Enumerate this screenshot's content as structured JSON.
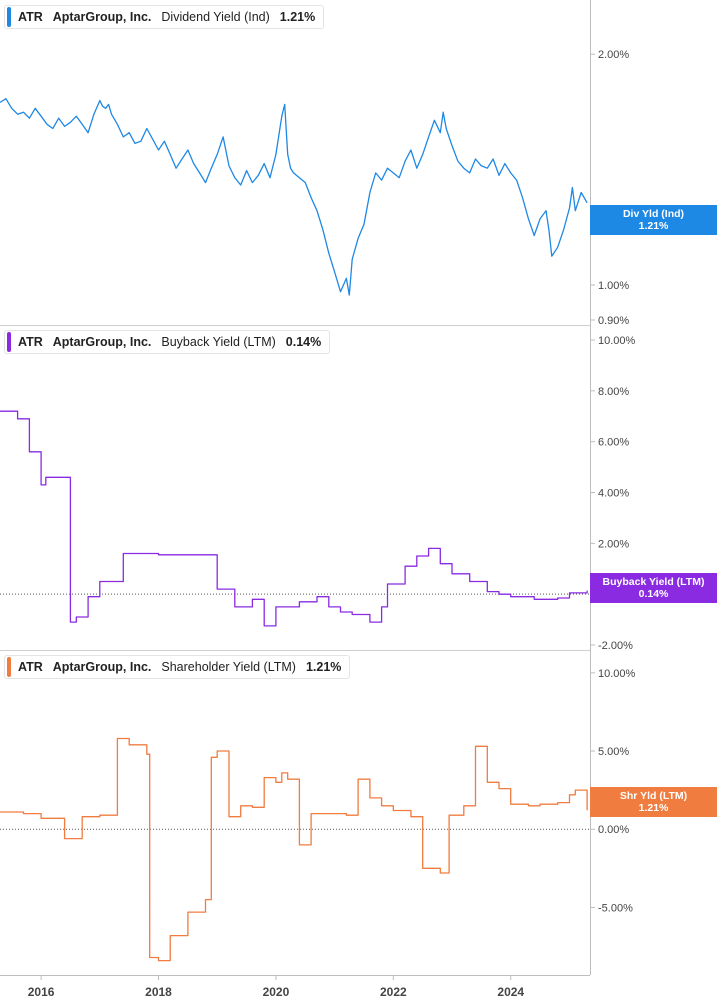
{
  "chart_data": [
    {
      "type": "line",
      "header": {
        "ticker": "ATR",
        "company": "AptarGroup, Inc.",
        "metric": "Dividend Yield (Ind)",
        "value": "1.21%"
      },
      "series": [
        {
          "name": "Dividend Yield (Ind)",
          "color": "#1e88e5",
          "x": [
            2015.3,
            2015.4,
            2015.5,
            2015.6,
            2015.7,
            2015.8,
            2015.9,
            2016.0,
            2016.1,
            2016.2,
            2016.3,
            2016.4,
            2016.5,
            2016.6,
            2016.7,
            2016.8,
            2016.9,
            2017.0,
            2017.05,
            2017.1,
            2017.15,
            2017.2,
            2017.3,
            2017.4,
            2017.5,
            2017.6,
            2017.7,
            2017.8,
            2017.9,
            2018.0,
            2018.1,
            2018.2,
            2018.3,
            2018.4,
            2018.5,
            2018.6,
            2018.7,
            2018.8,
            2018.9,
            2019.0,
            2019.1,
            2019.2,
            2019.3,
            2019.4,
            2019.5,
            2019.6,
            2019.7,
            2019.8,
            2019.9,
            2020.0,
            2020.1,
            2020.15,
            2020.2,
            2020.25,
            2020.3,
            2020.4,
            2020.5,
            2020.6,
            2020.7,
            2020.8,
            2020.9,
            2021.0,
            2021.1,
            2021.2,
            2021.25,
            2021.3,
            2021.4,
            2021.5,
            2021.6,
            2021.7,
            2021.8,
            2021.9,
            2022.0,
            2022.1,
            2022.2,
            2022.3,
            2022.4,
            2022.5,
            2022.6,
            2022.7,
            2022.8,
            2022.85,
            2022.9,
            2023.0,
            2023.1,
            2023.2,
            2023.3,
            2023.4,
            2023.5,
            2023.6,
            2023.7,
            2023.8,
            2023.9,
            2024.0,
            2024.1,
            2024.2,
            2024.3,
            2024.4,
            2024.5,
            2024.6,
            2024.65,
            2024.7,
            2024.8,
            2024.9,
            2025.0,
            2025.05,
            2025.1,
            2025.2,
            2025.3
          ],
          "values": [
            1.73,
            1.75,
            1.7,
            1.67,
            1.68,
            1.65,
            1.7,
            1.66,
            1.62,
            1.6,
            1.65,
            1.61,
            1.63,
            1.66,
            1.62,
            1.58,
            1.67,
            1.74,
            1.71,
            1.7,
            1.72,
            1.67,
            1.62,
            1.56,
            1.58,
            1.53,
            1.54,
            1.6,
            1.55,
            1.5,
            1.54,
            1.48,
            1.42,
            1.46,
            1.5,
            1.44,
            1.4,
            1.36,
            1.42,
            1.48,
            1.56,
            1.43,
            1.38,
            1.35,
            1.41,
            1.36,
            1.39,
            1.44,
            1.38,
            1.48,
            1.66,
            1.72,
            1.48,
            1.42,
            1.4,
            1.38,
            1.36,
            1.3,
            1.25,
            1.18,
            1.1,
            1.04,
            0.98,
            1.02,
            0.97,
            1.08,
            1.15,
            1.2,
            1.32,
            1.4,
            1.37,
            1.42,
            1.4,
            1.38,
            1.45,
            1.5,
            1.42,
            1.48,
            1.56,
            1.64,
            1.58,
            1.68,
            1.6,
            1.52,
            1.45,
            1.42,
            1.4,
            1.46,
            1.43,
            1.42,
            1.46,
            1.39,
            1.44,
            1.4,
            1.37,
            1.3,
            1.22,
            1.16,
            1.22,
            1.25,
            1.18,
            1.09,
            1.12,
            1.18,
            1.26,
            1.34,
            1.25,
            1.32,
            1.28
          ]
        }
      ],
      "ylim": [
        0.9,
        2.25
      ],
      "log_scale": true,
      "yticks": [
        0.9,
        1.0,
        2.0
      ],
      "ytick_labels": [
        "0.90%",
        "1.00%",
        "2.00%"
      ],
      "last_value_label": {
        "title": "Div Yld (Ind)",
        "value": "1.21%",
        "color": "#1e88e5"
      }
    },
    {
      "type": "line",
      "header": {
        "ticker": "ATR",
        "company": "AptarGroup, Inc.",
        "metric": "Buyback Yield (LTM)",
        "value": "0.14%"
      },
      "series": [
        {
          "name": "Buyback Yield (LTM)",
          "color": "#8a2be2",
          "step": true,
          "x": [
            2015.3,
            2015.6,
            2015.8,
            2016.0,
            2016.08,
            2016.5,
            2016.6,
            2016.8,
            2017.0,
            2017.4,
            2017.6,
            2018.0,
            2018.4,
            2018.8,
            2019.0,
            2019.3,
            2019.6,
            2019.8,
            2020.0,
            2020.4,
            2020.7,
            2020.9,
            2021.1,
            2021.3,
            2021.6,
            2021.8,
            2021.9,
            2022.2,
            2022.4,
            2022.6,
            2022.8,
            2023.0,
            2023.3,
            2023.6,
            2023.8,
            2024.0,
            2024.4,
            2024.8,
            2025.0,
            2025.3
          ],
          "values": [
            7.2,
            6.9,
            5.6,
            4.3,
            4.6,
            -1.1,
            -0.9,
            -0.1,
            0.5,
            1.6,
            1.6,
            1.55,
            1.55,
            1.55,
            0.2,
            -0.5,
            -0.2,
            -1.25,
            -0.5,
            -0.3,
            -0.1,
            -0.5,
            -0.7,
            -0.8,
            -1.1,
            -0.5,
            0.4,
            1.1,
            1.5,
            1.8,
            1.2,
            0.8,
            0.5,
            0.1,
            0.0,
            -0.1,
            -0.2,
            -0.15,
            0.05,
            0.14
          ]
        }
      ],
      "ylim": [
        -2.0,
        10.0
      ],
      "yticks": [
        -2,
        2,
        4,
        6,
        8,
        10
      ],
      "ytick_labels": [
        "-2.00%",
        "2.00%",
        "4.00%",
        "6.00%",
        "8.00%",
        "10.00%"
      ],
      "zero_line": true,
      "last_value_label": {
        "title": "Buyback Yield (LTM)",
        "value": "0.14%",
        "color": "#8a2be2"
      }
    },
    {
      "type": "line",
      "header": {
        "ticker": "ATR",
        "company": "AptarGroup, Inc.",
        "metric": "Shareholder Yield (LTM)",
        "value": "1.21%"
      },
      "series": [
        {
          "name": "Shareholder Yield (LTM)",
          "color": "#f07c40",
          "step": true,
          "x": [
            2015.3,
            2015.7,
            2016.0,
            2016.4,
            2016.7,
            2017.0,
            2017.3,
            2017.5,
            2017.8,
            2017.85,
            2018.0,
            2018.2,
            2018.5,
            2018.8,
            2018.9,
            2019.0,
            2019.2,
            2019.4,
            2019.6,
            2019.8,
            2020.0,
            2020.1,
            2020.2,
            2020.4,
            2020.6,
            2020.9,
            2021.2,
            2021.4,
            2021.6,
            2021.8,
            2022.0,
            2022.3,
            2022.5,
            2022.8,
            2022.95,
            2023.2,
            2023.4,
            2023.6,
            2023.8,
            2024.0,
            2024.3,
            2024.5,
            2024.8,
            2025.0,
            2025.1,
            2025.3
          ],
          "values": [
            1.1,
            1.0,
            0.7,
            -0.6,
            0.8,
            0.9,
            5.8,
            5.4,
            4.8,
            -8.2,
            -8.4,
            -6.8,
            -5.3,
            -4.5,
            4.6,
            5.0,
            0.8,
            1.5,
            1.4,
            3.3,
            3.0,
            3.6,
            3.2,
            -1.0,
            1.0,
            1.0,
            0.9,
            3.2,
            2.0,
            1.5,
            1.2,
            0.8,
            -2.5,
            -2.8,
            0.9,
            1.5,
            5.3,
            3.0,
            2.6,
            1.6,
            1.5,
            1.6,
            1.7,
            2.2,
            2.5,
            1.21
          ]
        }
      ],
      "ylim": [
        -9.0,
        10.5
      ],
      "yticks": [
        -5,
        0,
        5,
        10
      ],
      "ytick_labels": [
        "-5.00%",
        "0.00%",
        "5.00%",
        "10.00%"
      ],
      "zero_line": true,
      "last_value_label": {
        "title": "Shr Yld (LTM)",
        "value": "1.21%",
        "color": "#f07c40"
      }
    }
  ],
  "x_axis": {
    "ticks": [
      2016,
      2018,
      2020,
      2022,
      2024
    ],
    "labels": [
      "2016",
      "2018",
      "2020",
      "2022",
      "2024"
    ],
    "range": [
      2015.3,
      2025.35
    ]
  }
}
